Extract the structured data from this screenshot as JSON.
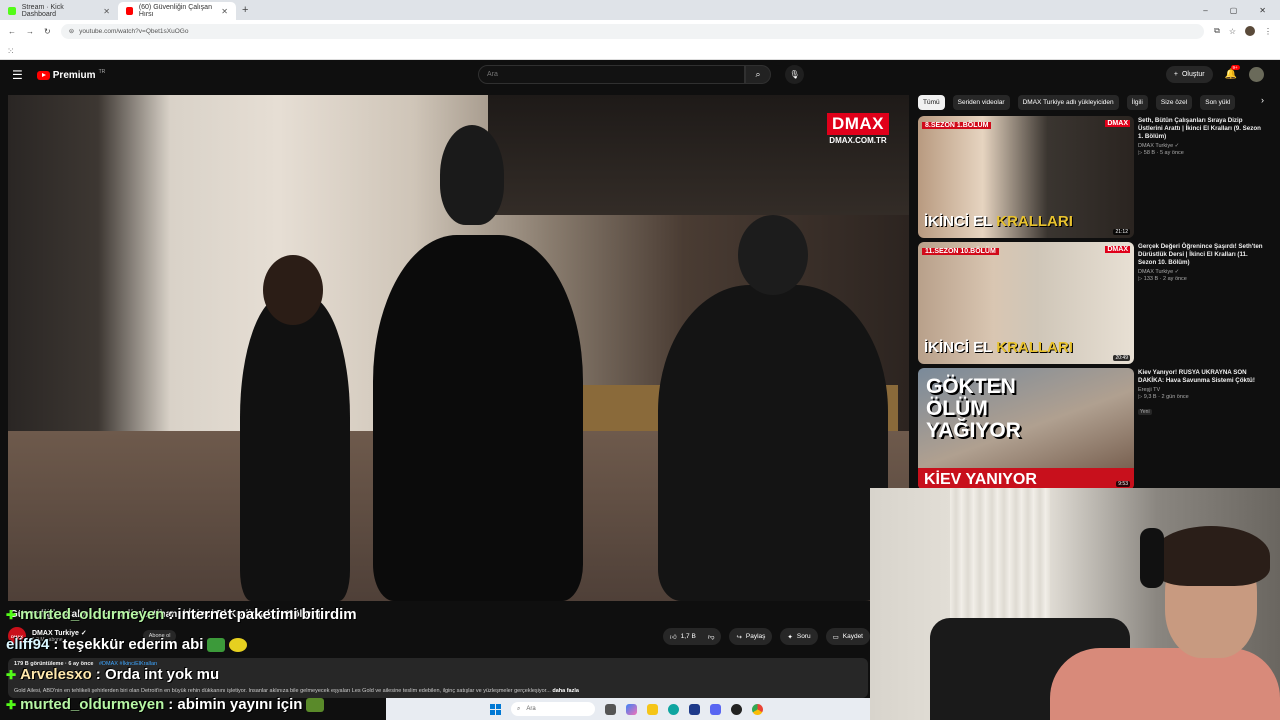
{
  "browser": {
    "tabs": [
      {
        "title": "Stream · Kick Dashboard",
        "active": false,
        "color": "#53fc18"
      },
      {
        "title": "(60) Güvenliğin Çalışan Hırsı",
        "active": true,
        "color": "#ff0000"
      }
    ],
    "new_tab": "+",
    "url": "youtube.com/watch?v=Qbet1sXuOGo",
    "window_controls": [
      "–",
      "▢",
      "✕"
    ]
  },
  "header": {
    "logo_text": "Premium",
    "logo_sup": "TR",
    "search_placeholder": "Ara",
    "create_label": "Oluştur",
    "notif_count": "9+"
  },
  "player": {
    "watermark": "DMAX",
    "watermark_sub": "DMAX.COM.TR"
  },
  "chips": [
    "Tümü",
    "Seriden videolar",
    "DMAX Turkiye adlı yükleyiciden",
    "İlgili",
    "Size özel",
    "Son yükl"
  ],
  "recommendations": [
    {
      "thumb_season": "8.SEZON 1.BÖLÜM",
      "thumb_title_a": "İKİNCİ EL ",
      "thumb_title_b": "KRALLARI",
      "duration": "21:12",
      "title": "Seth, Bütün Çalışanları Sıraya Dizip Üstlerini Arattı | İkinci El Kralları (9. Sezon 1. Bölüm)",
      "channel": "DMAX Turkiye ✓",
      "meta": "▷ 58 B · 5 ay önce",
      "badge": ""
    },
    {
      "thumb_season": "11.SEZON 10.BÖLÜM",
      "thumb_title_a": "İKİNCİ EL ",
      "thumb_title_b": "KRALLARI",
      "duration": "20:49",
      "title": "Gerçek Değeri Öğrenince Şaşırdı! Seth'ten Dürüstlük Dersi | İkinci El Kralları (11. Sezon 10. Bölüm)",
      "channel": "DMAX Turkiye ✓",
      "meta": "▷ 133 B · 2 ay önce",
      "badge": ""
    },
    {
      "thumb_lines": [
        "GÖKTEN",
        "ÖLÜM",
        "YAĞIYOR"
      ],
      "thumb_bar": "KİEV YANIYOR",
      "duration": "9:53",
      "title": "Kiev Yanıyor! RUSYA UKRAYNA SON DAKİKA: Hava Savunma Sistemi Çöktü!",
      "channel": "Ereşji TV",
      "meta": "▷ 9,3 B · 2 gün önce",
      "badge": "Yeni"
    }
  ],
  "below": {
    "title": "Güvenliğin Çalışan Hırsı ile İmtihanı | İkinci El Kralları (12. Bölüm)",
    "channel": "DMAX Turkiye ✓",
    "channel_avatar": "DMAX",
    "subs": "1,2 Mn abone",
    "subscribe": "Abone ol",
    "likes": "1,7 B",
    "share": "Paylaş",
    "ask": "Soru",
    "save": "Kaydet",
    "desc_meta": "179 B görüntüleme · 6 ay önce",
    "desc_tags": "#DMAX #İkinciElKralları",
    "desc_body": "Gold Ailesi, ABD'nin en tehlikeli şehirlerden biri olan Detroit'in en büyük rehin dükkanını işletiyor. İnsanlar aklınıza bile gelmeyecek eşyaları Les Gold ve ailesine teslim edebilen, ilginç satışlar ve yüzleşmeler gerçekleşiyor...",
    "more": "daha fazla"
  },
  "chat": [
    {
      "user": "murted_oldurmeyen",
      "message": ": internet paketimi bitirdim",
      "style": "green"
    },
    {
      "user": "eliff94",
      "message": ": teşekkür ederim abi",
      "style": "cyan"
    },
    {
      "user": "Arvelesxo",
      "message": ": Orda int yok mu",
      "style": "pink"
    },
    {
      "user": "murted_oldurmeyen",
      "message": ": abimin yayını için",
      "style": "green"
    }
  ],
  "taskbar": {
    "search_placeholder": "Ara"
  }
}
